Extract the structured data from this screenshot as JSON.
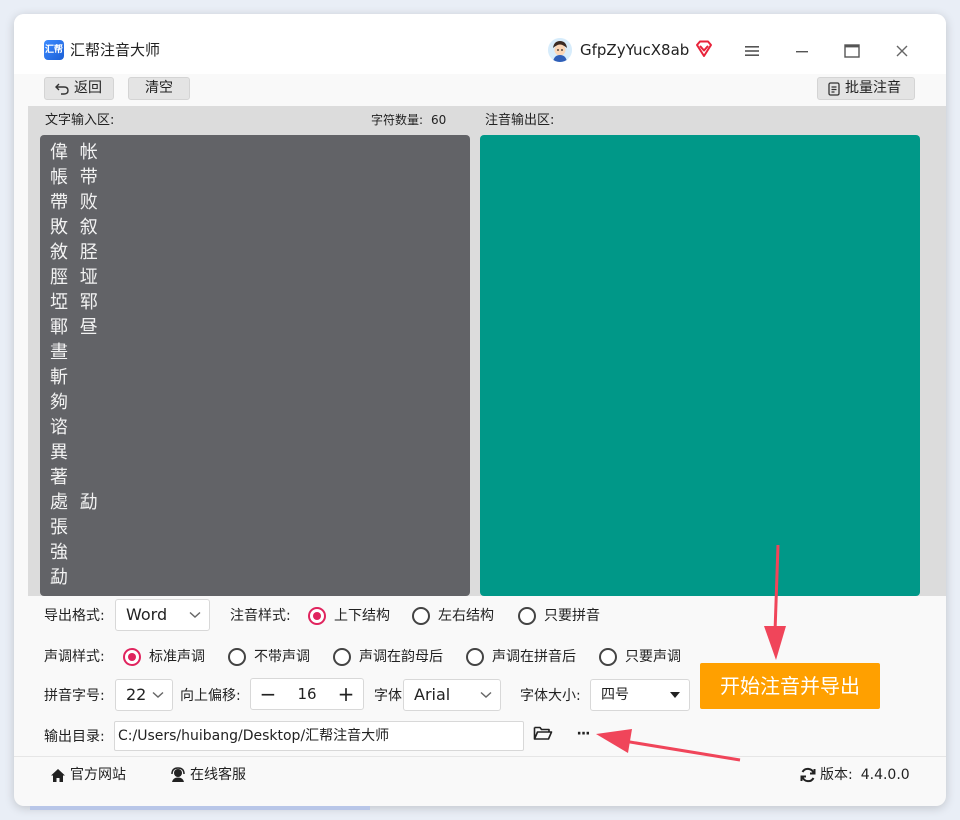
{
  "app": {
    "title": "汇帮注音大师",
    "logo_text": "汇帮"
  },
  "user": {
    "name": "GfpZyYucX8ab"
  },
  "toolbar": {
    "back_label": "返回",
    "clear_label": "清空",
    "batch_label": "批量注音"
  },
  "input_area": {
    "label": "文字输入区:",
    "char_count_label": "字符数量:",
    "char_count": "60",
    "text": "偉 帐\n帳 带\n帶 败\n敗 叙\n敘 胫\n脛 垭\n埡 郓\n鄆 昼\n晝\n斬\n夠\n谘\n異\n著\n處 勐\n張\n強\n勐"
  },
  "output_area": {
    "label": "注音输出区:",
    "color": "#009888"
  },
  "options": {
    "export_format_label": "导出格式:",
    "export_format_value": "Word",
    "style_label": "注音样式:",
    "style_options": [
      "上下结构",
      "左右结构",
      "只要拼音"
    ],
    "tone_label": "声调样式:",
    "tone_options": [
      "标准声调",
      "不带声调",
      "声调在韵母后",
      "声调在拼音后",
      "只要声调"
    ],
    "pinyin_size_label": "拼音字号:",
    "pinyin_size_value": "22",
    "offset_label": "向上偏移:",
    "offset_value": "16",
    "font_label": "字体:",
    "font_value": "Arial",
    "font_size_label": "字体大小:",
    "font_size_value": "四号",
    "output_dir_label": "输出目录:",
    "output_dir_value": "C:/Users/huibang/Desktop/汇帮注音大师",
    "more_label": "···"
  },
  "primary_action": {
    "label": "开始注音并导出",
    "color": "#ffa000"
  },
  "status": {
    "website_label": "官方网站",
    "support_label": "在线客服",
    "version_label": "版本:",
    "version_value": "4.4.0.0"
  },
  "colors": {
    "accent": "#e0245e",
    "annotation_arrow": "#f0455a"
  }
}
